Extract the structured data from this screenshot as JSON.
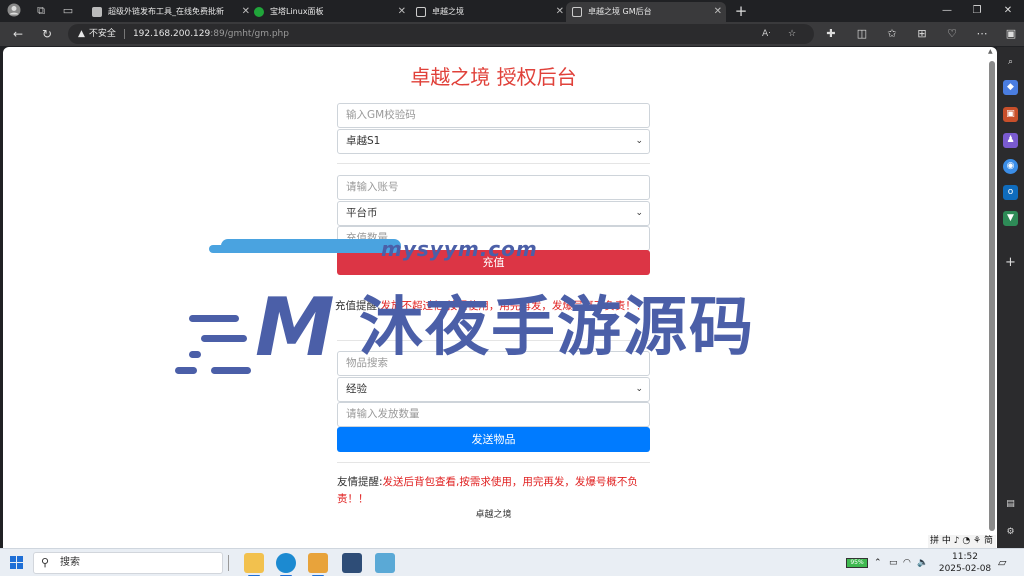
{
  "browser": {
    "tabs": [
      {
        "title": "超级外链发布工具_在线免费批新",
        "active": false
      },
      {
        "title": "宝塔Linux面板",
        "active": false
      },
      {
        "title": "卓越之境",
        "active": false
      },
      {
        "title": "卓越之境 GM后台",
        "active": true
      }
    ],
    "address": {
      "security": "不安全",
      "host": "192.168.200.129",
      "path": ":89/gmht/gm.php"
    }
  },
  "page": {
    "title": "卓越之境 授权后台",
    "gm_code": {
      "placeholder": "输入GM校验码"
    },
    "server_select": {
      "value": "卓越S1"
    },
    "recharge": {
      "account": {
        "placeholder": "请输入账号"
      },
      "currency_select": {
        "value": "平台币"
      },
      "amount": {
        "placeholder": "充值数量"
      },
      "button": "充值",
      "notice_label": "充值提醒:",
      "notice_text": "发放不超过亿,按需使用，用完再发，发爆号概不负责！！"
    },
    "items": {
      "search": {
        "placeholder": "物品搜索"
      },
      "item_select": {
        "value": "经验"
      },
      "quantity": {
        "placeholder": "请输入发放数量"
      },
      "button": "发送物品",
      "notice_label": "友情提醒:",
      "notice_text": "发送后背包查看,按需求使用，用完再发，发爆号概不负责！！"
    },
    "footer": "卓越之境"
  },
  "watermark": {
    "domain": "mysyym.com",
    "brand": "沐夜手游源码",
    "logo_letter": "M"
  },
  "ime": {
    "text": "拼 中 ♪ ◔ ⚘ 简 ◎ ⠿"
  },
  "taskbar": {
    "search_label": "搜索",
    "battery": "95%",
    "time": "11:52",
    "date": "2025-02-08"
  },
  "colors": {
    "title_red": "#e0413a",
    "danger": "#dc3545",
    "primary": "#007bff",
    "watermark": "#4b5fa8"
  }
}
